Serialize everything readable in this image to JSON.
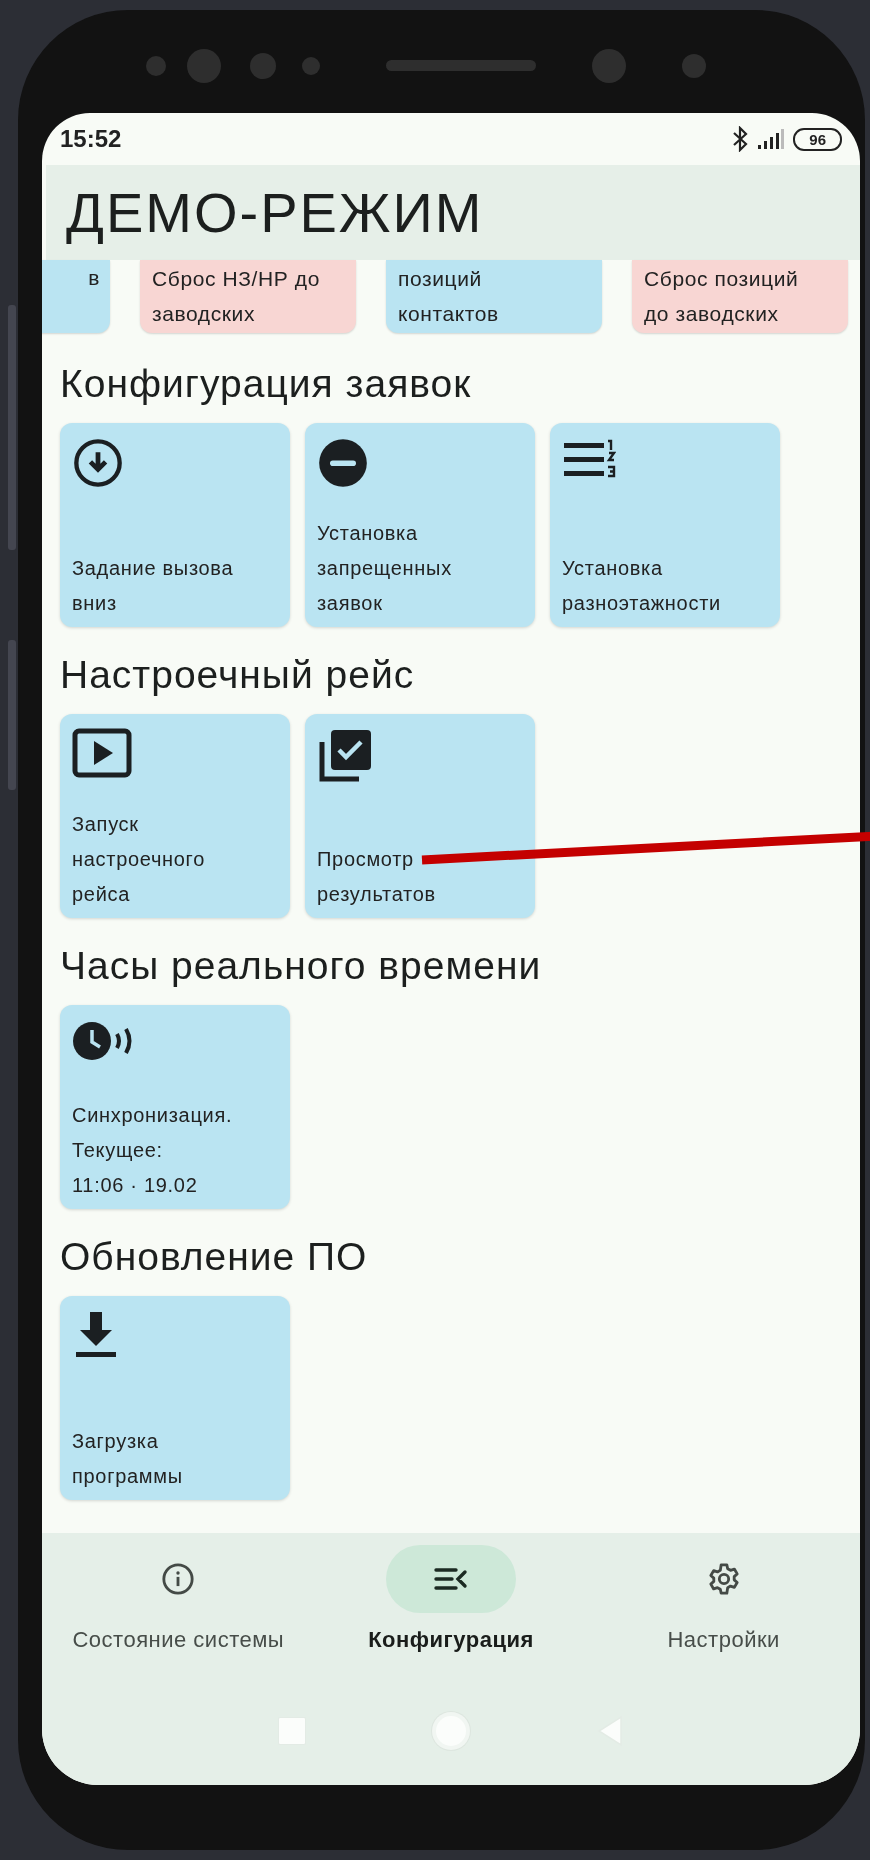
{
  "status_bar": {
    "time": "15:52",
    "battery": "96"
  },
  "header": {
    "title": "ДЕМО-РЕЖИМ"
  },
  "partial_cards": [
    {
      "label": "в",
      "color": "#bae4f2"
    },
    {
      "label": "Сброс НЗ/НР до\nзаводских",
      "color": "#f8d6d3"
    },
    {
      "label": "позиций\nконтактов",
      "color": "#bae4f2"
    },
    {
      "label": "Сброс позиций\nдо заводских",
      "color": "#f8d6d3"
    }
  ],
  "sections": [
    {
      "title": "Конфигурация заявок",
      "cards": [
        {
          "kind": "arrow-down-circle",
          "label": "Задание вызова\nвниз"
        },
        {
          "kind": "minus-circle",
          "label": "Установка\nзапрещенных\nзаявок"
        },
        {
          "kind": "numbered-list",
          "label": "Установка\nразноэтажности"
        }
      ]
    },
    {
      "title": "Настроечный рейс",
      "cards": [
        {
          "kind": "play",
          "label": "Запуск\nнастроечного\nрейса"
        },
        {
          "kind": "checked-stack",
          "label": "Просмотр\nрезультатов"
        }
      ]
    },
    {
      "title": "Часы реального времени",
      "cards": [
        {
          "kind": "clock-waves",
          "label": "Синхронизация.\nТекущее:\n11:06  ·  19.02"
        }
      ]
    },
    {
      "title": "Обновление ПО",
      "cards": [
        {
          "kind": "download",
          "label": "Загрузка\nпрограммы"
        }
      ]
    }
  ],
  "nav": [
    {
      "kind": "info",
      "label": "Состояние системы",
      "selected": false
    },
    {
      "kind": "config",
      "label": "Конфигурация",
      "selected": true
    },
    {
      "kind": "settings",
      "label": "Настройки",
      "selected": false
    }
  ]
}
